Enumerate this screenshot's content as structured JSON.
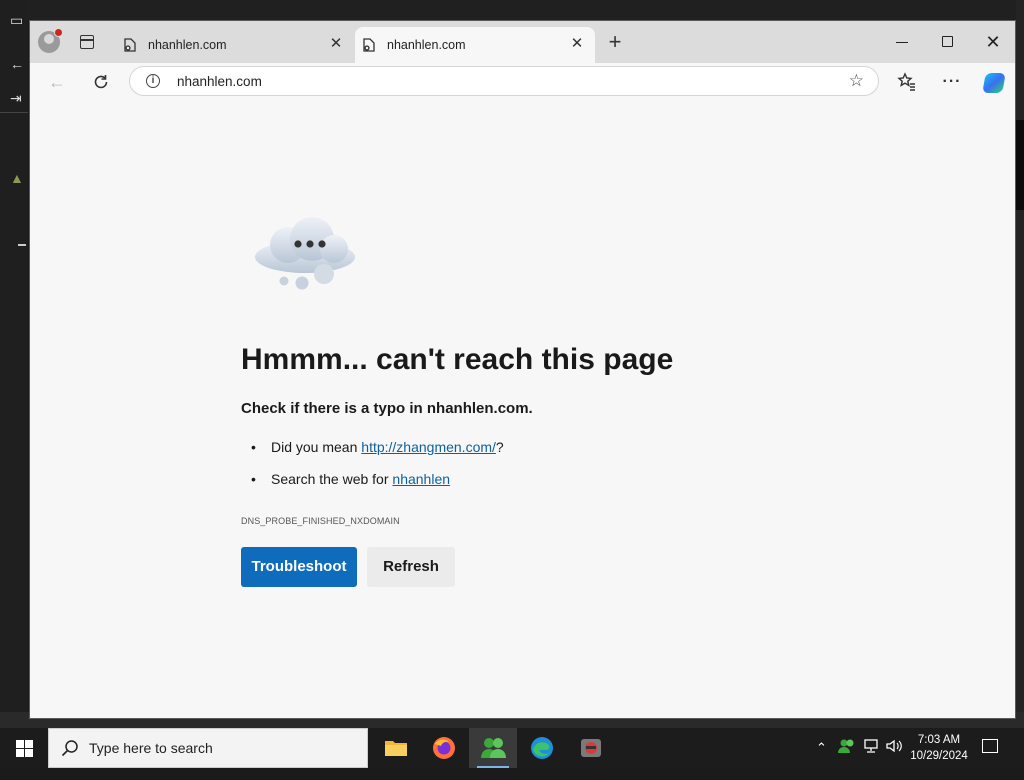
{
  "browser": {
    "tabs": [
      {
        "title": "nhanhlen.com",
        "active": false
      },
      {
        "title": "nhanhlen.com",
        "active": true
      }
    ],
    "address": {
      "url": "nhanhlen.com"
    }
  },
  "error_page": {
    "headline": "Hmmm... can't reach this page",
    "subline": "Check if there is a typo in nhanhlen.com.",
    "suggestion_1": {
      "prefix": "Did you mean ",
      "link": "http://zhangmen.com/",
      "suffix": "?"
    },
    "suggestion_2": {
      "prefix": "Search the web for ",
      "link": "nhanhlen"
    },
    "error_code": "DNS_PROBE_FINISHED_NXDOMAIN",
    "primary_button": "Troubleshoot",
    "secondary_button": "Refresh"
  },
  "taskbar": {
    "search_placeholder": "Type here to search",
    "apps": [
      "file-explorer-icon",
      "firefox-icon",
      "people-icon",
      "edge-icon",
      "game-icon"
    ],
    "clock": {
      "time": "7:03 AM",
      "date": "10/29/2024"
    }
  },
  "colors": {
    "accent": "#0f6cbd",
    "link": "#0f5f9e"
  }
}
